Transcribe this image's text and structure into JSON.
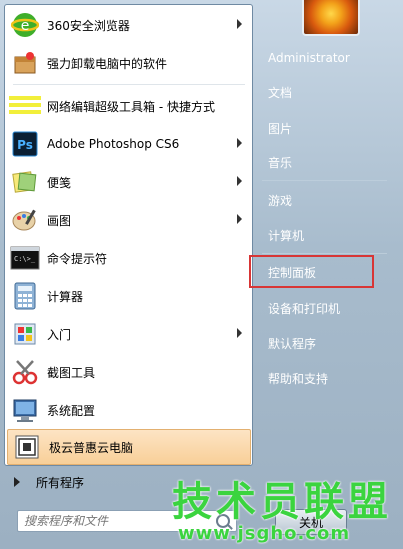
{
  "left_items": [
    {
      "label": "360安全浏览器",
      "icon": "browser-360-icon",
      "arrow": true
    },
    {
      "label": "强力卸载电脑中的软件",
      "icon": "uninstall-box-icon",
      "arrow": false
    },
    {
      "label": "网络编辑超级工具箱 - 快捷方式",
      "icon": "toolbox-icon",
      "arrow": false
    },
    {
      "label": "Adobe Photoshop CS6",
      "icon": "photoshop-icon",
      "arrow": true
    },
    {
      "label": "便笺",
      "icon": "sticky-notes-icon",
      "arrow": true
    },
    {
      "label": "画图",
      "icon": "paint-palette-icon",
      "arrow": true
    },
    {
      "label": "命令提示符",
      "icon": "cmd-icon",
      "arrow": false
    },
    {
      "label": "计算器",
      "icon": "calculator-icon",
      "arrow": false
    },
    {
      "label": "入门",
      "icon": "getting-started-icon",
      "arrow": true
    },
    {
      "label": "截图工具",
      "icon": "snipping-tool-icon",
      "arrow": false
    },
    {
      "label": "系统配置",
      "icon": "system-config-icon",
      "arrow": false
    },
    {
      "label": "极云普惠云电脑",
      "icon": "cloud-pc-icon",
      "arrow": false,
      "highlighted": true
    }
  ],
  "all_programs": "所有程序",
  "search": {
    "placeholder": "搜索程序和文件"
  },
  "right_links": [
    {
      "label": "Administrator"
    },
    {
      "label": "文档"
    },
    {
      "label": "图片"
    },
    {
      "label": "音乐"
    },
    {
      "label": "游戏"
    },
    {
      "label": "计算机"
    },
    {
      "label": "控制面板"
    },
    {
      "label": "设备和打印机"
    },
    {
      "label": "默认程序"
    },
    {
      "label": "帮助和支持"
    }
  ],
  "shutdown": {
    "label": "关机"
  },
  "watermark": {
    "title": "技术员联盟",
    "url": "www.jsgho.com"
  },
  "colors": {
    "accent": "#f8cf98",
    "highlight_border": "#d83535",
    "watermark": "#3bd43f"
  }
}
